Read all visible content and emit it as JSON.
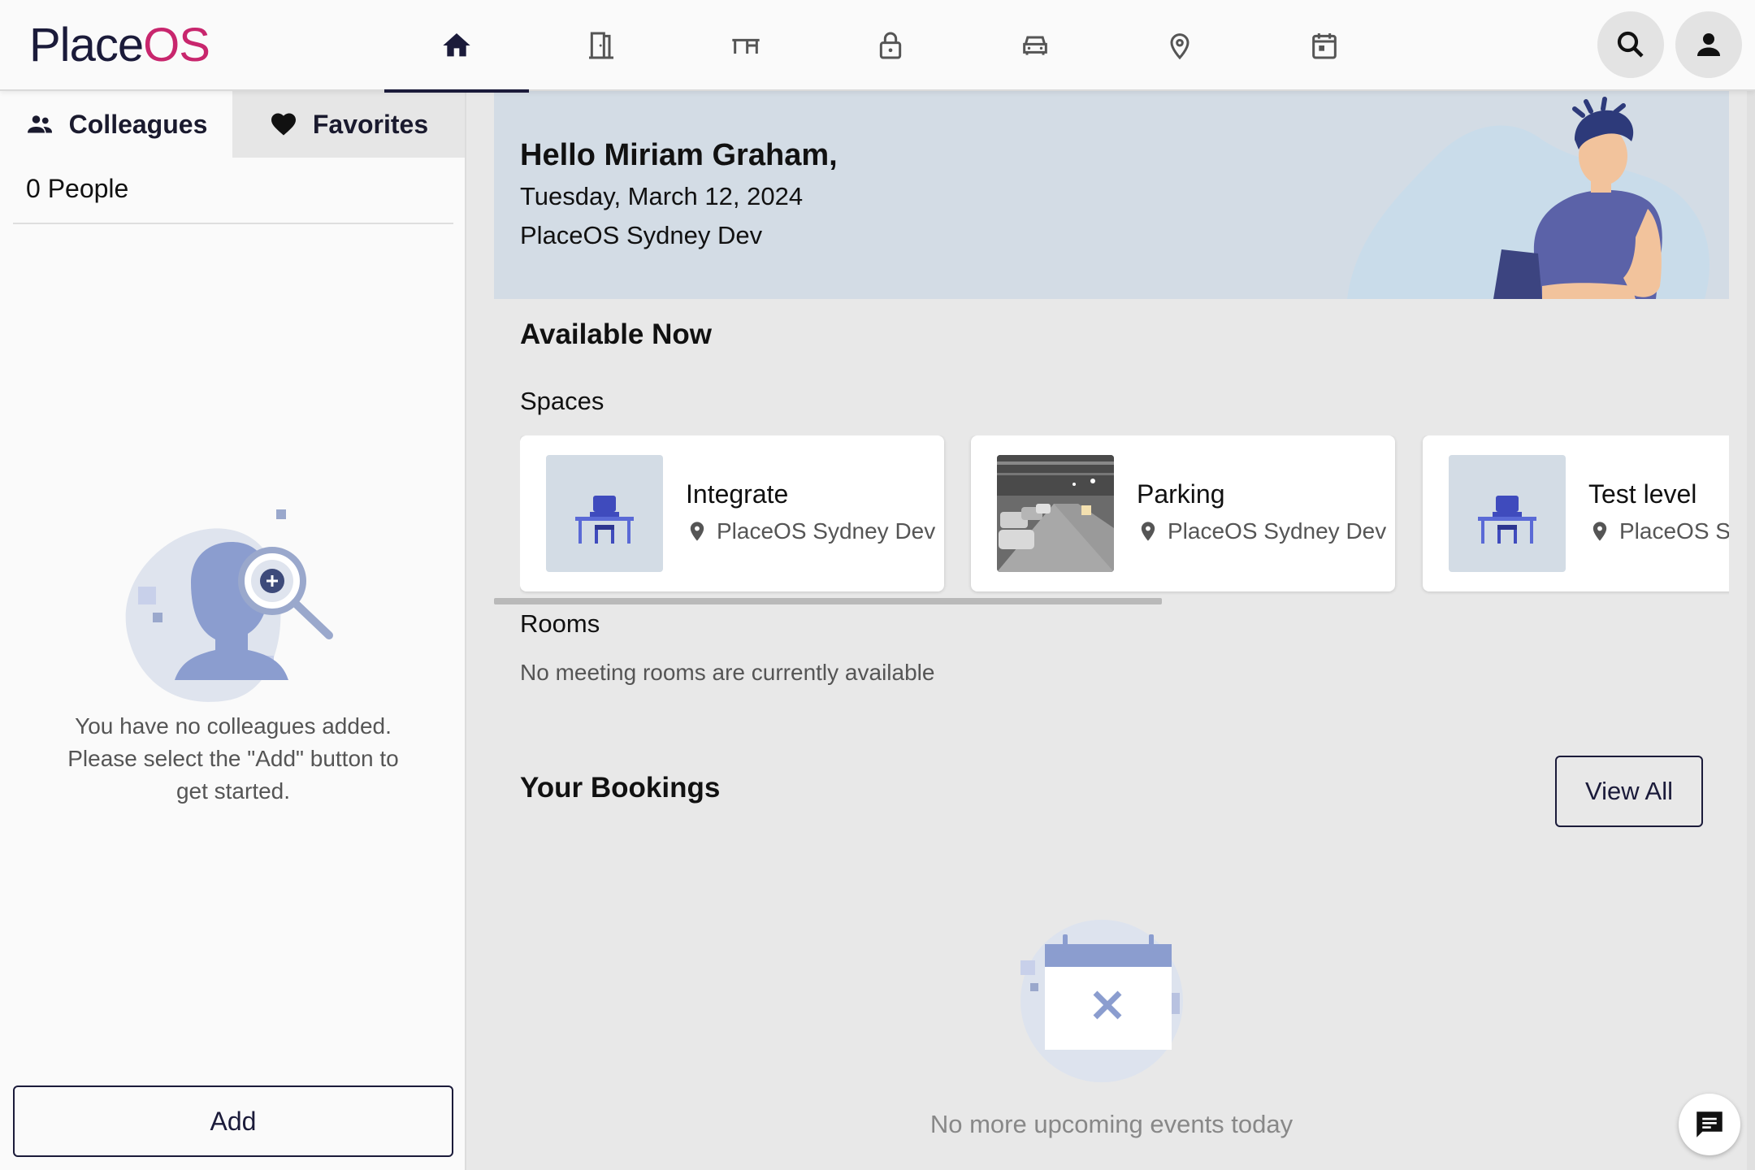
{
  "app": {
    "logo_part1": "Place",
    "logo_part2": "OS"
  },
  "nav": {
    "items": [
      {
        "icon": "home-icon",
        "active": true
      },
      {
        "icon": "door-icon",
        "active": false
      },
      {
        "icon": "desk-icon",
        "active": false
      },
      {
        "icon": "locker-icon",
        "active": false
      },
      {
        "icon": "car-icon",
        "active": false
      },
      {
        "icon": "location-pin-icon",
        "active": false
      },
      {
        "icon": "calendar-icon",
        "active": false
      }
    ],
    "search_icon": "search-icon",
    "account_icon": "person-icon"
  },
  "sidebar": {
    "tabs": [
      {
        "label": "Colleagues",
        "icon": "people-icon",
        "active": true
      },
      {
        "label": "Favorites",
        "icon": "heart-icon",
        "active": false
      }
    ],
    "people_count": "0 People",
    "empty_line1": "You have no colleagues added.",
    "empty_line2": "Please select the \"Add\" button to",
    "empty_line3": "get started.",
    "add_label": "Add"
  },
  "hero": {
    "greeting": "Hello Miriam Graham,",
    "date": "Tuesday, March 12, 2024",
    "location": "PlaceOS Sydney Dev"
  },
  "available": {
    "title": "Available Now",
    "spaces_title": "Spaces",
    "spaces": [
      {
        "name": "Integrate",
        "location": "PlaceOS Sydney Dev",
        "thumb": "desk-icon"
      },
      {
        "name": "Parking",
        "location": "PlaceOS Sydney Dev",
        "thumb": "parking-photo"
      },
      {
        "name": "Test level",
        "location": "PlaceOS Sydney Dev",
        "thumb": "desk-icon"
      }
    ],
    "rooms_title": "Rooms",
    "rooms_empty": "No meeting rooms are currently available"
  },
  "bookings": {
    "title": "Your Bookings",
    "view_all_label": "View All",
    "empty": "No more upcoming events today"
  },
  "colors": {
    "brand_dark": "#1b1b3a",
    "brand_pink": "#c8266d",
    "hero_bg": "#d3dce5",
    "accent_blue": "#3f4bbd"
  }
}
